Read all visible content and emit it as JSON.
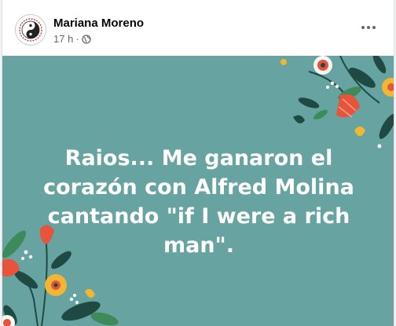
{
  "post": {
    "author": "Mariana Moreno",
    "time": "17 h",
    "separator": "·",
    "privacy_icon": "globe-icon",
    "menu_icon": "more-options-icon",
    "avatar_icon": "yin-yang-icon",
    "text": "Raios... Me ganaron el corazón con Alfred Molina cantando \"if I were a rich man\".",
    "background_color": "#66a3a1"
  },
  "colors": {
    "accent_red": "#e8533b",
    "accent_yellow": "#f2b632",
    "leaf_dark": "#1f4a44",
    "leaf_green": "#3e8a5a"
  }
}
